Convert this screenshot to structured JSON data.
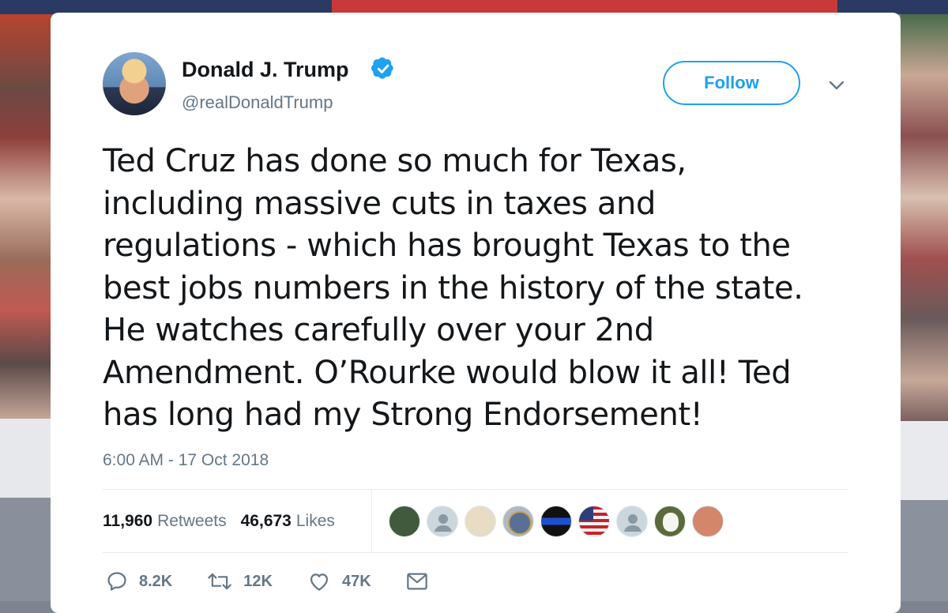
{
  "tweet": {
    "author_name": "Donald J. Trump",
    "author_handle": "@realDonaldTrump",
    "follow_label": "Follow",
    "text": "Ted Cruz has done so much for Texas,\nincluding massive cuts in taxes and\nregulations - which has brought Texas to the\nbest jobs numbers in the history of the state.\nHe watches carefully over your 2nd\nAmendment. O’Rourke would blow it all! Ted\nhas long had my Strong Endorsement!",
    "timestamp": "6:00 AM - 17 Oct 2018"
  },
  "stats": {
    "retweets_count": "11,960",
    "retweets_label": "Retweets",
    "likes_count": "46,673",
    "likes_label": "Likes"
  },
  "actions": {
    "replies": "8.2K",
    "retweets": "12K",
    "likes": "47K"
  },
  "colors": {
    "accent": "#1da1f2",
    "text": "#14171a",
    "secondary_text": "#657786"
  },
  "liker_avatars": [
    {
      "name": "green-face-avatar",
      "color": "#3f5a3c"
    },
    {
      "name": "default-avatar",
      "color": "#ccd6dd"
    },
    {
      "name": "beige-document-avatar",
      "color": "#e8dcc4"
    },
    {
      "name": "memorial-seal-avatar",
      "color": "#b0b8c4"
    },
    {
      "name": "blue-line-flag-avatar",
      "color": "#d11f1f"
    },
    {
      "name": "us-flag-avatar",
      "color": "#3b5b92"
    },
    {
      "name": "default-avatar",
      "color": "#ccd6dd"
    },
    {
      "name": "dog-avatar",
      "color": "#5a6a3a"
    },
    {
      "name": "hands-avatar",
      "color": "#d4866a"
    }
  ],
  "icons": {
    "verified": "verified-badge-icon",
    "chevron": "chevron-down-icon",
    "reply": "reply-icon",
    "retweet": "retweet-icon",
    "like": "heart-icon",
    "dm": "envelope-icon"
  }
}
